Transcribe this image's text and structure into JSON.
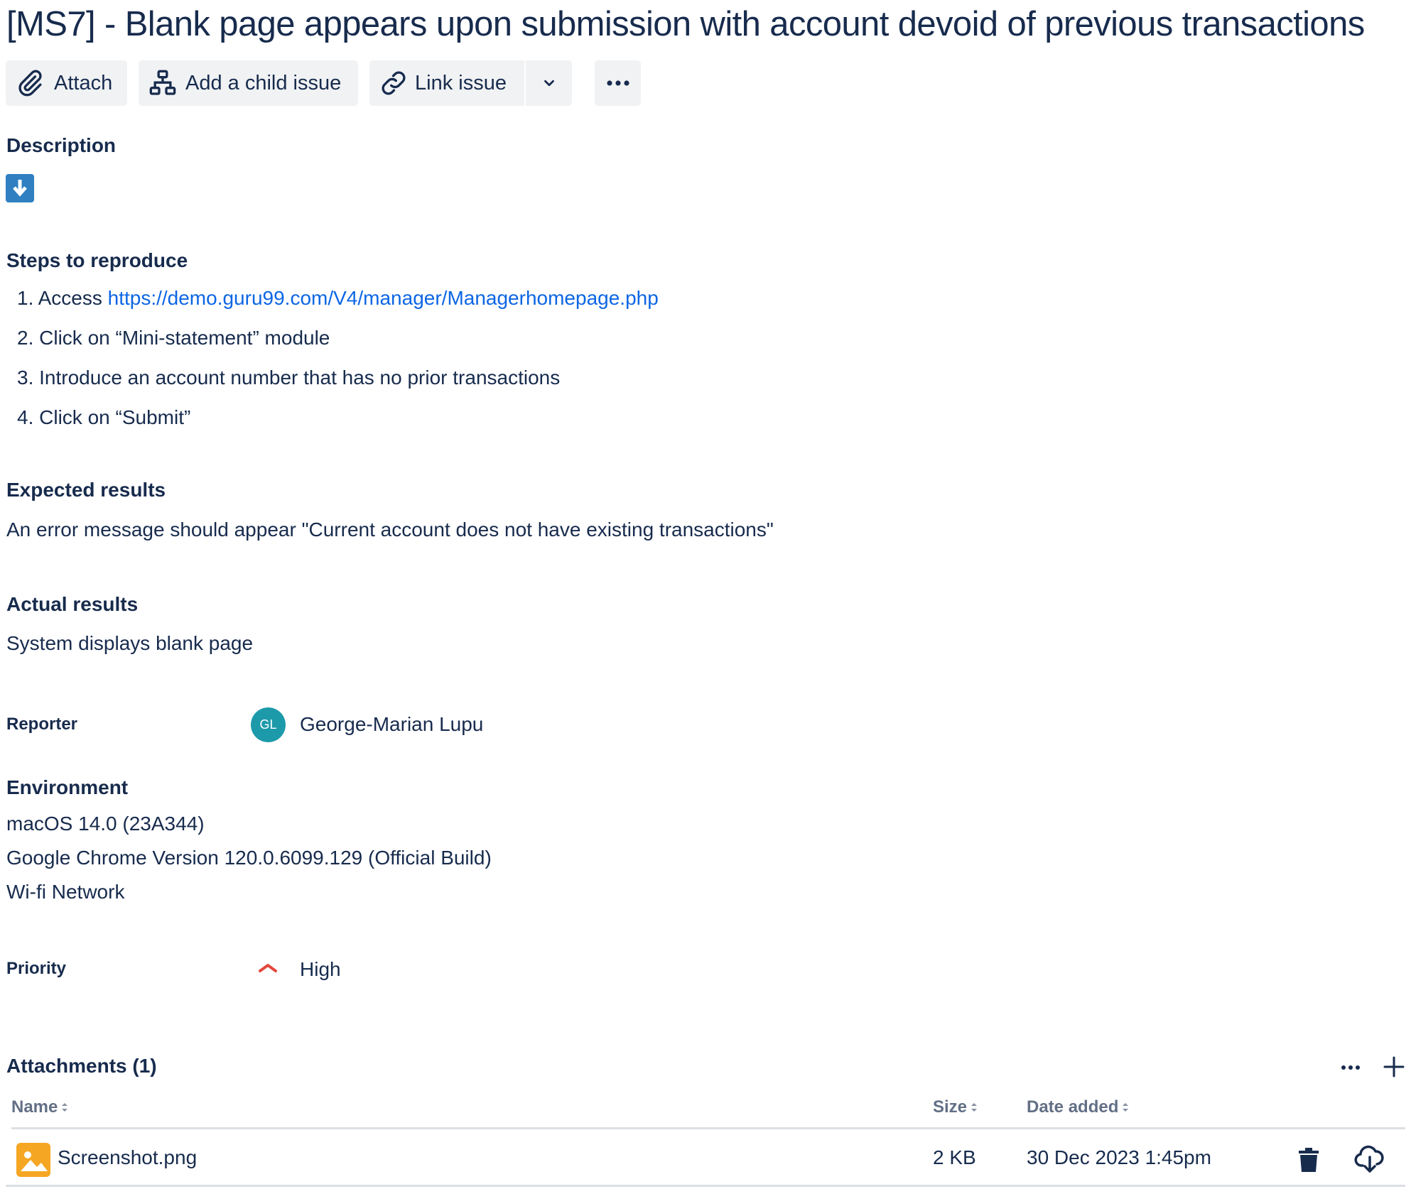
{
  "issue": {
    "title": "[MS7] - Blank page appears upon submission with account devoid of previous transactions"
  },
  "toolbar": {
    "attach_label": "Attach",
    "add_child_label": "Add a child issue",
    "link_issue_label": "Link issue"
  },
  "description": {
    "heading": "Description",
    "steps_heading": "Steps to reproduce",
    "steps": [
      {
        "num": "1.",
        "prefix": "Access ",
        "link": "https://demo.guru99.com/V4/manager/Managerhomepage.php"
      },
      {
        "num": "2.",
        "text": "Click on “Mini-statement” module"
      },
      {
        "num": "3.",
        "text": "Introduce an account number that has no prior transactions"
      },
      {
        "num": "4.",
        "text": "Click on “Submit”"
      }
    ],
    "expected_heading": "Expected results",
    "expected_text": "An error message should appear \"Current account does not have existing transactions\"",
    "actual_heading": "Actual results",
    "actual_text": "System displays blank page"
  },
  "reporter": {
    "label": "Reporter",
    "initials": "GL",
    "name": "George-Marian Lupu",
    "avatar_color": "#1d9aaa"
  },
  "environment": {
    "heading": "Environment",
    "lines": [
      "macOS 14.0 (23A344)",
      "Google Chrome Version 120.0.6099.129 (Official Build)",
      "Wi-fi Network"
    ]
  },
  "priority": {
    "label": "Priority",
    "value": "High",
    "icon": "priority-high-icon",
    "color": "#e2483d"
  },
  "attachments": {
    "heading": "Attachments (1)",
    "columns": {
      "name": "Name",
      "size": "Size",
      "date": "Date added"
    },
    "rows": [
      {
        "name": "Screenshot.png",
        "size": "2 KB",
        "date": "30 Dec 2023 1:45pm",
        "icon": "image-file-icon"
      }
    ]
  },
  "colors": {
    "text": "#172b4d",
    "link": "#0c66e4",
    "button_bg": "#f1f2f4",
    "info_icon": "#2f7fc1",
    "file_icon": "#f5a623"
  }
}
